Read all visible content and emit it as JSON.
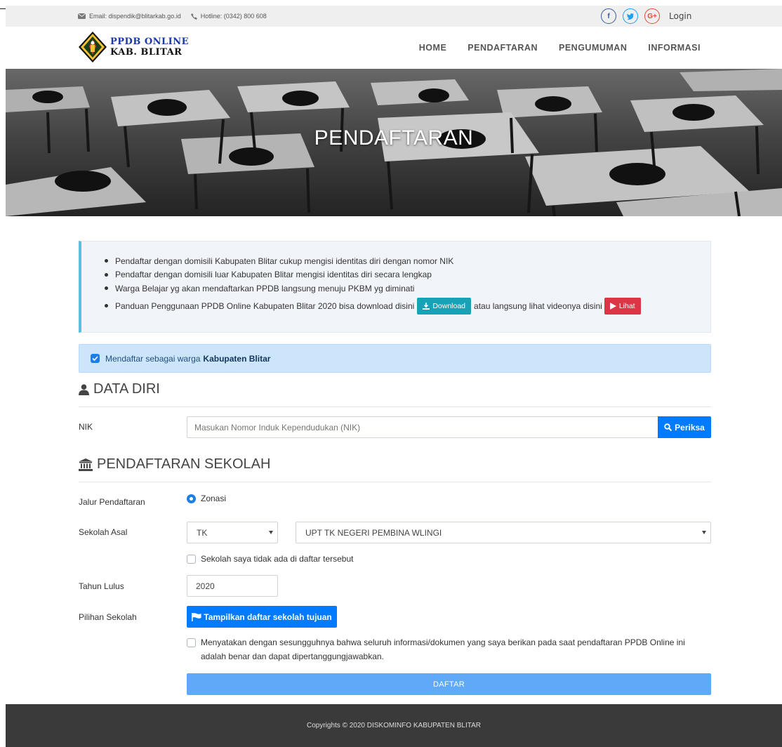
{
  "topbar": {
    "email": "Email: dispendik@blitarkab.go.id",
    "hotline": "Hotline: (0342) 800 608",
    "login": "Login"
  },
  "brand": {
    "line1": "PPDB ONLINE",
    "line2": "KAB. BLITAR"
  },
  "nav": [
    "HOME",
    "PENDAFTARAN",
    "PENGUMUMAN",
    "INFORMASI"
  ],
  "hero": {
    "title": "PENDAFTARAN"
  },
  "info": {
    "items": [
      "Pendaftar dengan domisili Kabupaten Blitar cukup mengisi identitas diri dengan nomor NIK",
      "Pendaftar dengan domisili luar Kabupaten Blitar mengisi identitas diri secara lengkap",
      "Warga Belajar yg akan mendaftarkan PPDB langsung menuju PKBM yg diminati"
    ],
    "guide_text": "Panduan Penggunaan PPDB Online Kabupaten Blitar 2020 bisa download disini",
    "download_label": "Download",
    "video_text": "atau langsung lihat videonya disini",
    "lihat_label": "Lihat"
  },
  "warga": {
    "text": "Mendaftar sebagai warga",
    "bold": "Kabupaten Blitar",
    "checked": true
  },
  "data_diri": {
    "title": "DATA DIRI",
    "nik_label": "NIK",
    "nik_placeholder": "Masukan Nomor Induk Kependudukan (NIK)",
    "periksa_label": "Periksa"
  },
  "sekolah": {
    "title": "PENDAFTARAN SEKOLAH",
    "jalur_label": "Jalur Pendaftaran",
    "jalur_value": "Zonasi",
    "asal_label": "Sekolah Asal",
    "asal_jenjang": "TK",
    "asal_nama": "UPT TK NEGERI PEMBINA WLINGI",
    "tidak_ada_label": "Sekolah saya tidak ada di daftar tersebut",
    "tahun_label": "Tahun Lulus",
    "tahun_value": "2020",
    "pilihan_label": "Pilihan Sekolah",
    "tampilkan_label": "Tampilkan daftar sekolah tujuan",
    "pernyataan_1": "Menyatakan dengan sesungguhnya bahwa seluruh informasi/dokumen yang saya berikan pada saat pendaftaran PPDB Online ini",
    "pernyataan_2": "adalah benar dan dapat dipertanggungjawabkan.",
    "daftar_label": "DAFTAR"
  },
  "footer": {
    "text": "Copyrights © 2020 DISKOMINFO KABUPATEN BLITAR"
  },
  "colors": {
    "primary": "#007bff",
    "info": "#17a2b8",
    "danger": "#dc3545",
    "brand_blue": "#1a3aa8",
    "footer_bg": "#3a3a3a"
  }
}
